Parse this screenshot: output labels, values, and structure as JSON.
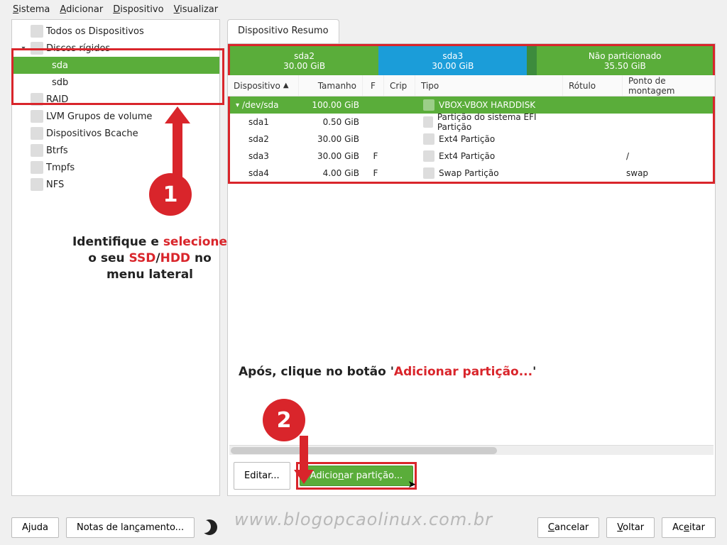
{
  "menubar": {
    "sistema": "Sistema",
    "adicionar": "Adicionar",
    "dispositivo": "Dispositivo",
    "visualizar": "Visualizar"
  },
  "sidebar": {
    "all_devices": "Todos os Dispositivos",
    "hard_disks": "Discos rígidos",
    "sda": "sda",
    "sdb": "sdb",
    "raid": "RAID",
    "lvm": "LVM Grupos de volume",
    "bcache": "Dispositivos Bcache",
    "btrfs": "Btrfs",
    "tmpfs": "Tmpfs",
    "nfs": "NFS"
  },
  "tab": {
    "resumo": "Dispositivo Resumo"
  },
  "partbar": {
    "seg1": {
      "name": "sda2",
      "size": "30.00 GiB"
    },
    "seg2": {
      "name": "sda3",
      "size": "30.00 GiB"
    },
    "seg3": {
      "name": "Não particionado",
      "size": "35.50 GiB"
    }
  },
  "columns": {
    "dev": "Dispositivo",
    "size": "Tamanho",
    "f": "F",
    "crip": "Crip",
    "tipo": "Tipo",
    "rot": "Rótulo",
    "mount": "Ponto de montagem"
  },
  "rows": {
    "disk": {
      "dev": "/dev/sda",
      "size": "100.00 GiB",
      "tipo": "VBOX-VBOX HARDDISK"
    },
    "r1": {
      "dev": "sda1",
      "size": "0.50 GiB",
      "f": "",
      "tipo": "Partição do sistema EFI Partição",
      "mount": ""
    },
    "r2": {
      "dev": "sda2",
      "size": "30.00 GiB",
      "f": "",
      "tipo": "Ext4 Partição",
      "mount": ""
    },
    "r3": {
      "dev": "sda3",
      "size": "30.00 GiB",
      "f": "F",
      "tipo": "Ext4 Partição",
      "mount": "/"
    },
    "r4": {
      "dev": "sda4",
      "size": "4.00 GiB",
      "f": "F",
      "tipo": "Swap Partição",
      "mount": "swap"
    }
  },
  "panel_buttons": {
    "editar": "Editar...",
    "adicionar_part": "Adicionar partição..."
  },
  "annotations": {
    "a1_pre": "Identifique e ",
    "a1_sel": "selecione",
    "a1_mid": " o seu ",
    "a1_ssd": "SSD",
    "a1_slash": "/",
    "a1_hdd": "HDD",
    "a1_post": " no menu lateral",
    "a2_pre": "Após, clique no botão '",
    "a2_red": "Adicionar partição...",
    "a2_post": "'",
    "badge1": "1",
    "badge2": "2"
  },
  "watermark": "www.blogopcaolinux.com.br",
  "footer": {
    "ajuda": "Ajuda",
    "notas": "Notas de lançamento...",
    "cancelar": "Cancelar",
    "voltar": "Voltar",
    "aceitar": "Aceitar"
  }
}
